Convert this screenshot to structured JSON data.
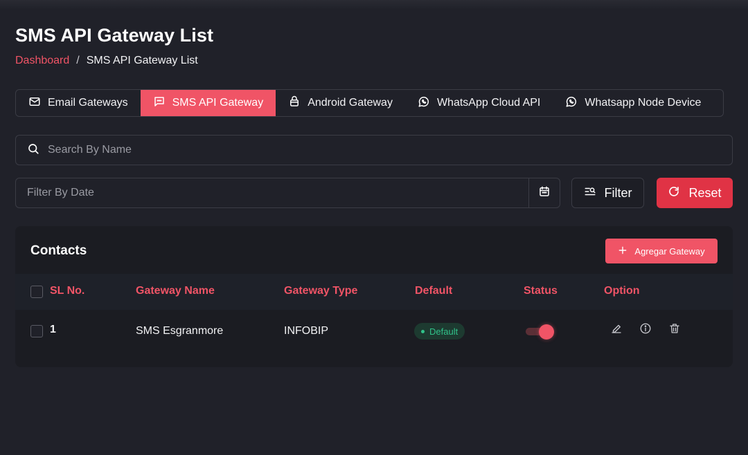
{
  "page": {
    "title": "SMS API Gateway List",
    "breadcrumb": {
      "home": "Dashboard",
      "separator": "/",
      "current": "SMS API Gateway List"
    }
  },
  "tabs": [
    {
      "label": "Email Gateways",
      "icon": "mail-icon",
      "active": false
    },
    {
      "label": "SMS API Gateway",
      "icon": "message-icon",
      "active": true
    },
    {
      "label": "Android Gateway",
      "icon": "android-icon",
      "active": false
    },
    {
      "label": "WhatsApp Cloud API",
      "icon": "whatsapp-icon",
      "active": false
    },
    {
      "label": "Whatsapp Node Device",
      "icon": "whatsapp-icon",
      "active": false
    }
  ],
  "search": {
    "placeholder": "Search By Name",
    "value": ""
  },
  "date_filter": {
    "placeholder": "Filter By Date",
    "value": ""
  },
  "buttons": {
    "filter": "Filter",
    "reset": "Reset"
  },
  "card": {
    "title": "Contacts",
    "add_button": "Agregar Gateway",
    "columns": [
      "SL No.",
      "Gateway Name",
      "Gateway Type",
      "Default",
      "Status",
      "Option"
    ],
    "rows": [
      {
        "sl": "1",
        "name": "SMS Esgranmore",
        "type": "INFOBIP",
        "default_badge": "Default",
        "status_on": true
      }
    ]
  },
  "colors": {
    "accent": "#f05466",
    "reset": "#e03345",
    "background": "#202129",
    "badge_text": "#31c28a"
  }
}
